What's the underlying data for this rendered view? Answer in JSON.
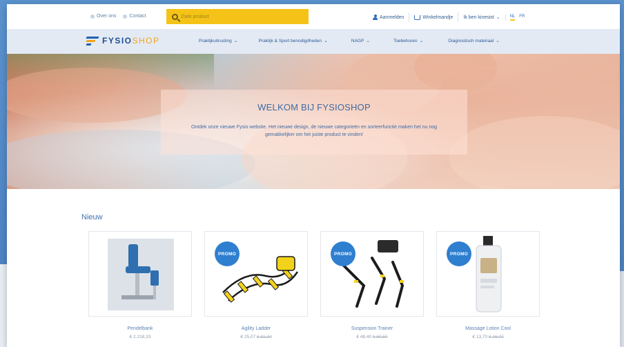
{
  "top": {
    "links": [
      {
        "label": "Over ons"
      },
      {
        "label": "Contact"
      }
    ],
    "search_placeholder": "Zoek product",
    "login": "Aanmelden",
    "cart": "Winkelmandje",
    "profile": "Ik ben kinesist",
    "languages": [
      "NL",
      "FR"
    ]
  },
  "nav": {
    "logo_main": "FYSIO",
    "logo_shop": "SHOP",
    "items": [
      "Praktijkuitrusting",
      "Praktijk & Sport benodigdheden",
      "NAGP",
      "Toebehoren",
      "Diagnostisch materiaal"
    ]
  },
  "hero": {
    "title": "WELKOM BIJ FYSIOSHOP",
    "text": "Ontdek onze nieuwe Fysio website. Het nieuwe design, de nieuwe categorieën en sorteerfunctie maken het nu nog gemakkelijker om het juiste product te vinden!"
  },
  "section": {
    "title": "Nieuw"
  },
  "products": [
    {
      "name": "Pendelbank",
      "price": "€ 2.218,33",
      "old_price": "",
      "promo": ""
    },
    {
      "name": "Agility Ladder",
      "price": "€ 25,07",
      "old_price": "€ 31,34",
      "promo": "PROMO"
    },
    {
      "name": "Suspension Trainer",
      "price": "€ 48,40",
      "old_price": "€ 60,50",
      "promo": "PROMO"
    },
    {
      "name": "Massage Lotion Cool",
      "price": "€ 13,70",
      "old_price": "€ 16,02",
      "promo": "PROMO"
    }
  ],
  "colors": {
    "accent": "#f5c318",
    "brand_blue": "#1f4f94",
    "promo_badge": "#2f7fd0"
  }
}
